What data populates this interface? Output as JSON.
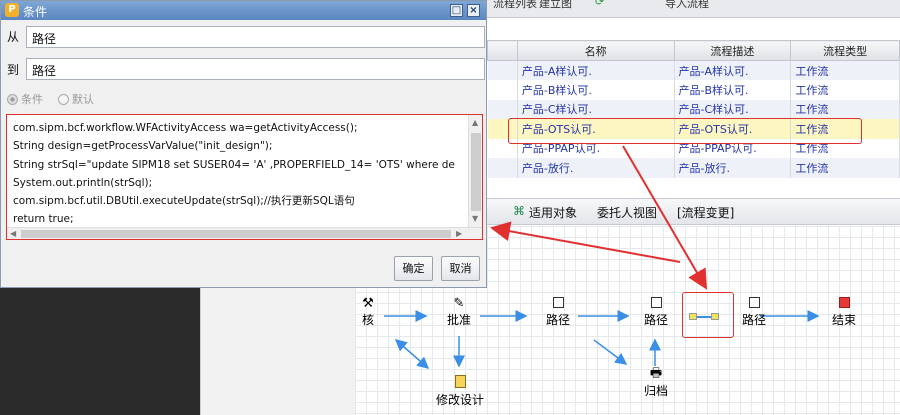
{
  "toolbar": {
    "item1": "流程列表",
    "item2": "建立图",
    "item3": "导入流程"
  },
  "table": {
    "headers": [
      "名称",
      "流程描述",
      "流程类型"
    ],
    "rows": [
      {
        "name": "产品-A样认可.",
        "desc": "产品-A样认可.",
        "type": "工作流"
      },
      {
        "name": "产品-B样认可.",
        "desc": "产品-B样认可.",
        "type": "工作流"
      },
      {
        "name": "产品-C样认可.",
        "desc": "产品-C样认可.",
        "type": "工作流"
      },
      {
        "name": "产品-OTS认可.",
        "desc": "产品-OTS认可.",
        "type": "工作流"
      },
      {
        "name": "产品-PPAP认可.",
        "desc": "产品-PPAP认可.",
        "type": "工作流"
      },
      {
        "name": "产品-放行.",
        "desc": "产品-放行.",
        "type": "工作流"
      }
    ]
  },
  "tabs": [
    "适用对象",
    "委托人视图",
    "[流程变更]"
  ],
  "flow": {
    "nodes": [
      "核",
      "批准",
      "路径",
      "路径",
      "路径",
      "结束",
      "修改设计",
      "归档"
    ]
  },
  "dialog": {
    "title": "条件",
    "from_label": "从",
    "from_value": "路径",
    "to_label": "到",
    "to_value": "路径",
    "radio1": "条件",
    "radio2": "默认",
    "code_lines": [
      "com.sipm.bcf.workflow.WFActivityAccess wa=getActivityAccess();",
      "String design=getProcessVarValue(\"init_design\");",
      "String strSql=\"update SIPM18 set SUSER04= 'A' ,PROPERFIELD_14= 'OTS' where de",
      "System.out.println(strSql);",
      "com.sipm.bcf.util.DBUtil.executeUpdate(strSql);//执行更新SQL语句",
      "return true;"
    ],
    "ok_label": "确定",
    "cancel_label": "取消"
  },
  "colors": {
    "accent_red": "#e03030",
    "flow_arrow": "#3a8ee6",
    "highlight_row": "#fdf6c0",
    "end_node": "#e53935"
  }
}
